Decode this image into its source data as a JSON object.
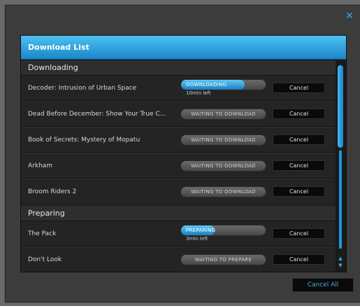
{
  "dialog": {
    "close_icon": "close-icon",
    "accent_color": "#3fa3e6"
  },
  "panel": {
    "title": "Download List"
  },
  "sections": {
    "downloading": {
      "label": "Downloading",
      "items": [
        {
          "title": "Decoder: Intrusion of Urban Space",
          "status": "DOWNLOADING",
          "progress": 0.75,
          "subtext": "10min left",
          "cancel": "Cancel"
        },
        {
          "title": "Dead Before December: Show Your True C...",
          "status": "WAITING TO DOWNLOAD",
          "cancel": "Cancel"
        },
        {
          "title": "Book of Secrets: Mystery of Mopatu",
          "status": "WAITING TO DOWNLOAD",
          "cancel": "Cancel"
        },
        {
          "title": "Arkham",
          "status": "WAITING TO DOWNLOAD",
          "cancel": "Cancel"
        },
        {
          "title": "Broom Riders 2",
          "status": "WAITING TO DOWNLOAD",
          "cancel": "Cancel"
        }
      ]
    },
    "preparing": {
      "label": "Preparing",
      "items": [
        {
          "title": "The Pack",
          "status": "PREPARING",
          "progress": 0.4,
          "subtext": "3min left",
          "cancel": "Cancel"
        },
        {
          "title": "Don't Look",
          "status": "WAITING TO PREPARE",
          "cancel": "Cancel"
        }
      ]
    }
  },
  "footer": {
    "cancel_all": "Cancel All"
  }
}
